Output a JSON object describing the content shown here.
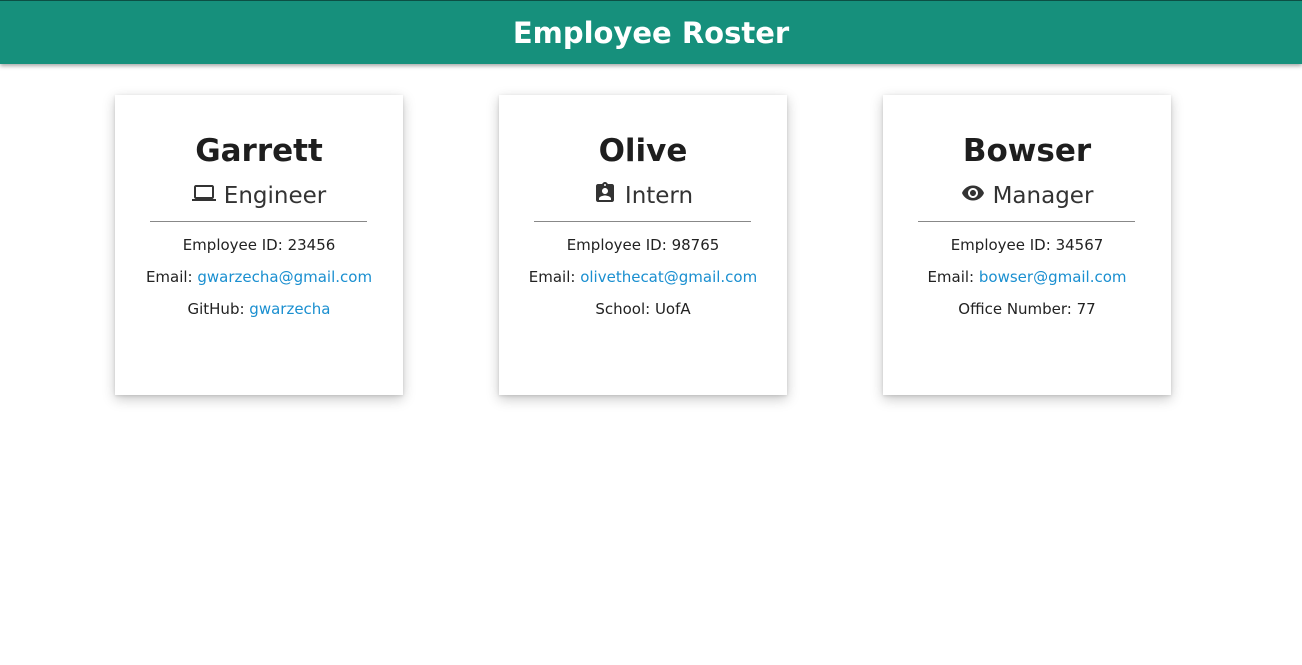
{
  "header": {
    "title": "Employee Roster"
  },
  "colors": {
    "header_bg": "#16907c",
    "link": "#1a8fd0",
    "text": "#1e1e1e"
  },
  "employees": [
    {
      "name": "Garrett",
      "role": "Engineer",
      "role_icon": "laptop-icon",
      "id_label": "Employee ID: ",
      "id": "23456",
      "email_label": "Email: ",
      "email": "gwarzecha@gmail.com",
      "extra_label": "GitHub: ",
      "extra_value": "gwarzecha"
    },
    {
      "name": "Olive",
      "role": "Intern",
      "role_icon": "badge-icon",
      "id_label": "Employee ID: ",
      "id": "98765",
      "email_label": "Email: ",
      "email": "olivethecat@gmail.com",
      "extra_label": "School: ",
      "extra_value": "UofA"
    },
    {
      "name": "Bowser",
      "role": "Manager",
      "role_icon": "eye-icon",
      "id_label": "Employee ID: ",
      "id": "34567",
      "email_label": "Email: ",
      "email": "bowser@gmail.com",
      "extra_label": "Office Number: ",
      "extra_value": "77"
    }
  ]
}
